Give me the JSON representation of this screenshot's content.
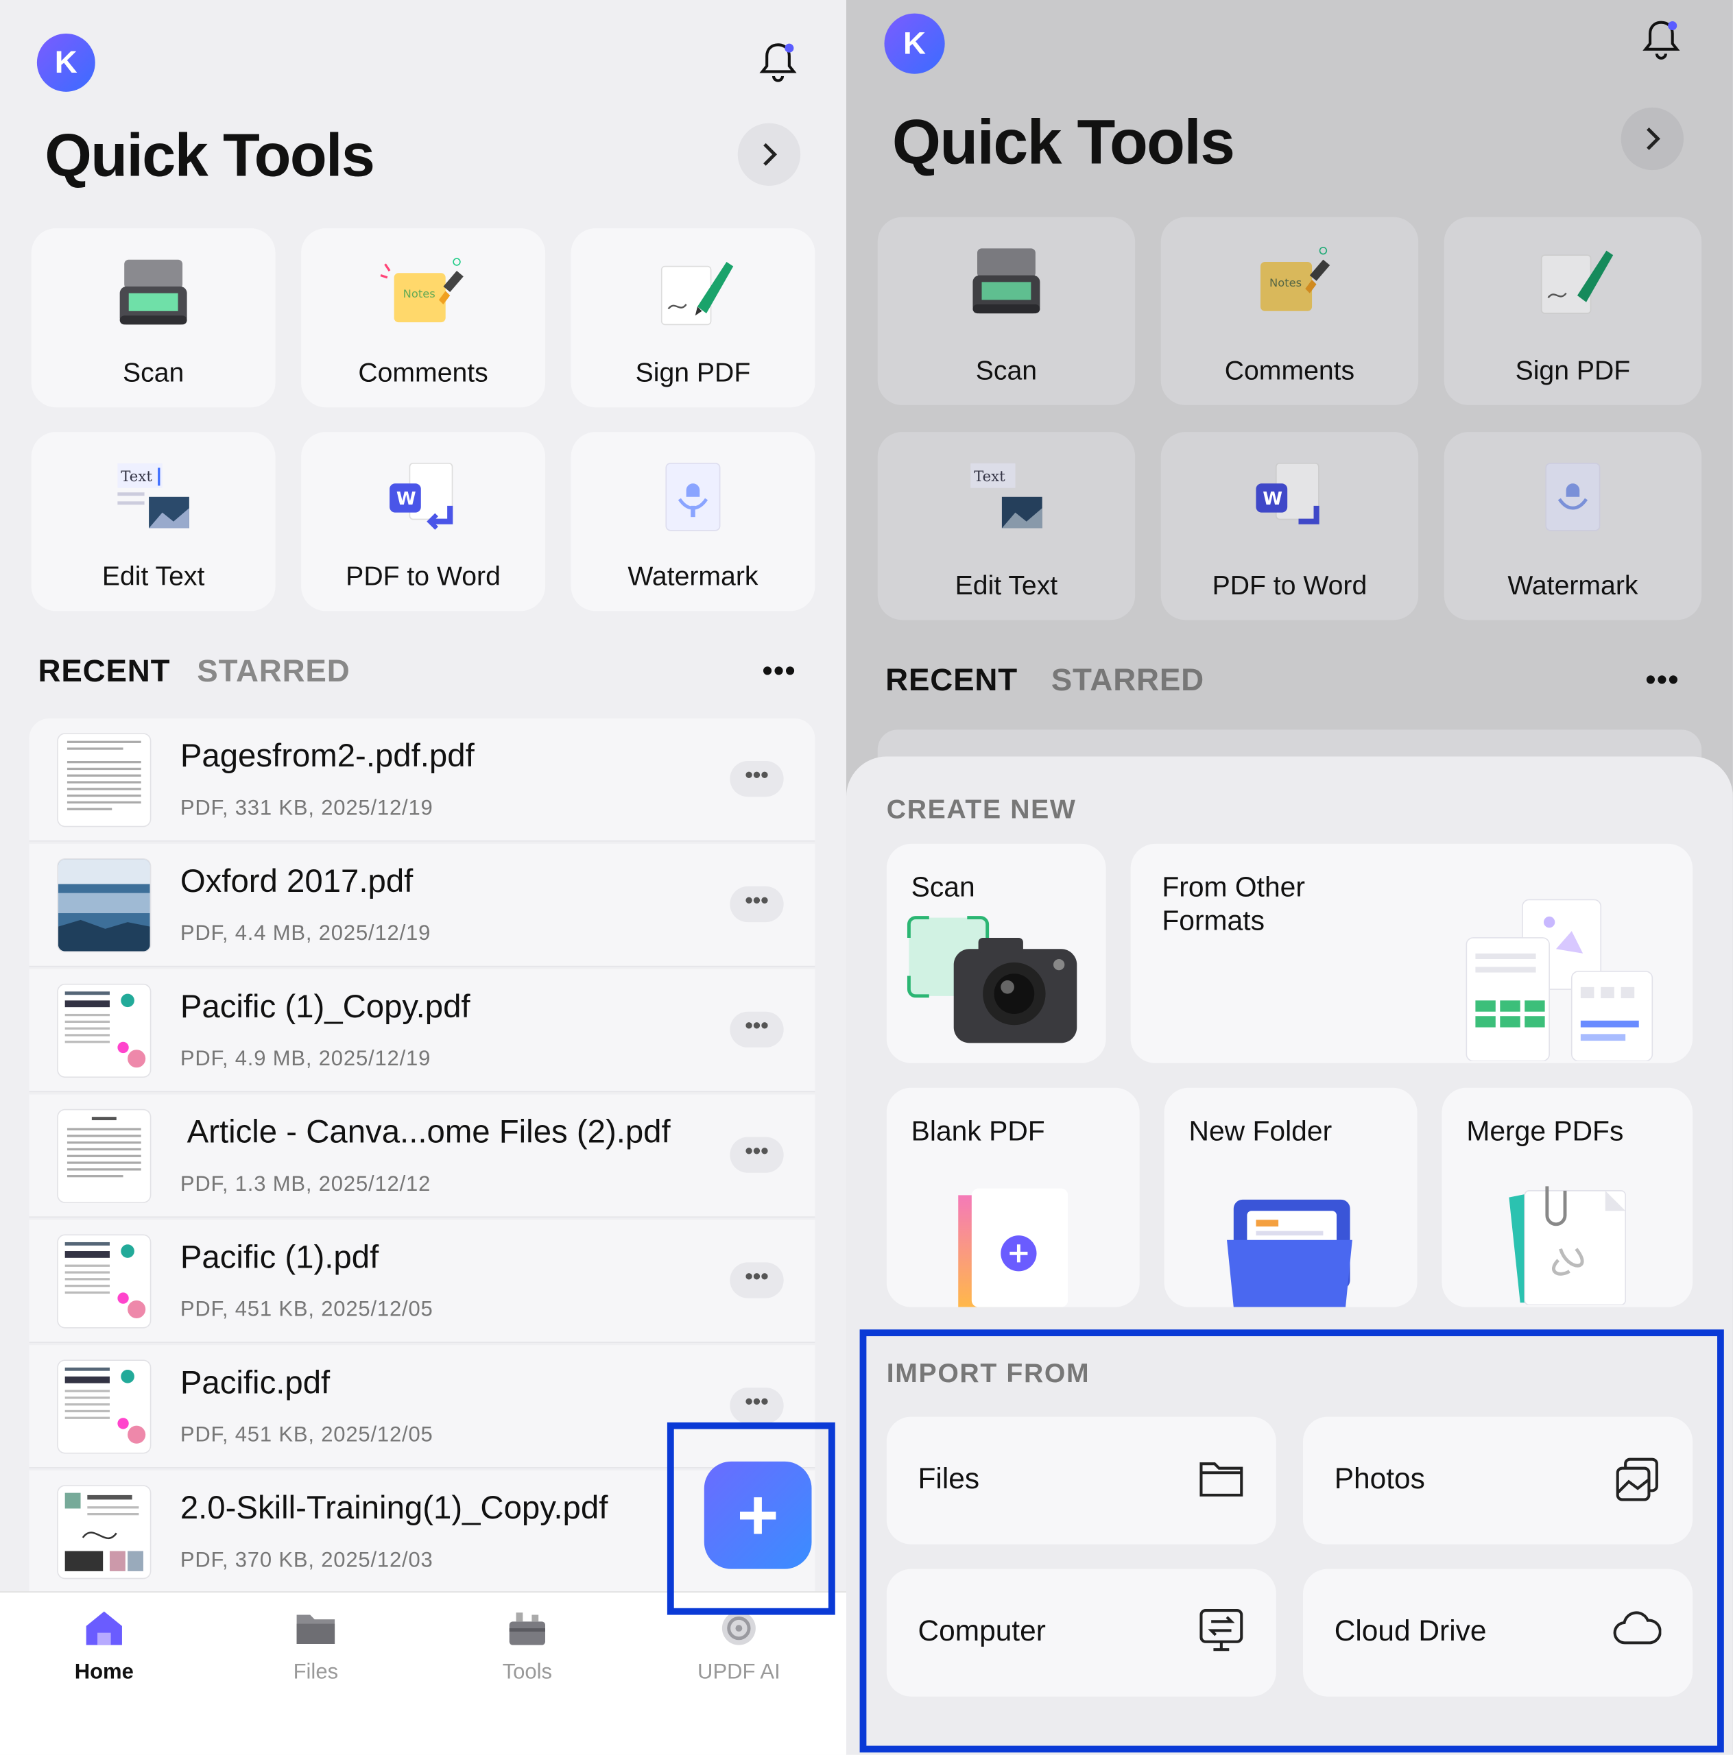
{
  "avatar_initial": "K",
  "header": {
    "title": "Quick Tools"
  },
  "quick_tools": [
    {
      "label": "Scan",
      "icon": "scanner-icon"
    },
    {
      "label": "Comments",
      "icon": "notes-icon"
    },
    {
      "label": "Sign PDF",
      "icon": "sign-pen-icon"
    },
    {
      "label": "Edit Text",
      "icon": "edit-text-icon"
    },
    {
      "label": "PDF to Word",
      "icon": "word-convert-icon"
    },
    {
      "label": "Watermark",
      "icon": "watermark-icon"
    }
  ],
  "tabs": {
    "recent": "RECENT",
    "starred": "STARRED"
  },
  "more_label": "•••",
  "files": [
    {
      "name": "Pagesfrom2-.pdf.pdf",
      "meta": "PDF, 331 KB, 2025/12/19"
    },
    {
      "name": "Oxford 2017.pdf",
      "meta": "PDF, 4.4 MB, 2025/12/19"
    },
    {
      "name": "Pacific (1)_Copy.pdf",
      "meta": "PDF, 4.9 MB, 2025/12/19"
    },
    {
      "name": "Article - Canva...ome Files (2).pdf",
      "meta": "PDF, 1.3 MB, 2025/12/12"
    },
    {
      "name": "Pacific (1).pdf",
      "meta": "PDF, 451 KB, 2025/12/05"
    },
    {
      "name": "Pacific.pdf",
      "meta": "PDF, 451 KB, 2025/12/05"
    },
    {
      "name": "2.0-Skill-Training(1)_Copy.pdf",
      "meta": "PDF, 370 KB, 2025/12/03"
    }
  ],
  "fab_label": "+",
  "bottom_nav": [
    {
      "label": "Home",
      "icon": "home-icon",
      "active": true
    },
    {
      "label": "Files",
      "icon": "folder-icon"
    },
    {
      "label": "Tools",
      "icon": "toolbox-icon"
    },
    {
      "label": "UPDF AI",
      "icon": "ai-icon"
    }
  ],
  "sheet": {
    "create_new_title": "CREATE NEW",
    "create_new": [
      {
        "label": "Scan",
        "icon": "camera-icon"
      },
      {
        "label": "From Other Formats",
        "icon": "formats-icon"
      },
      {
        "label": "Blank PDF",
        "icon": "blank-pdf-icon"
      },
      {
        "label": "New Folder",
        "icon": "new-folder-icon"
      },
      {
        "label": "Merge PDFs",
        "icon": "merge-icon"
      }
    ],
    "import_from_title": "IMPORT FROM",
    "import_from": [
      {
        "label": "Files",
        "icon": "folder-outline-icon"
      },
      {
        "label": "Photos",
        "icon": "photos-icon"
      },
      {
        "label": "Computer",
        "icon": "computer-transfer-icon"
      },
      {
        "label": "Cloud Drive",
        "icon": "cloud-icon"
      }
    ]
  },
  "colors": {
    "accent": "#3b6cff",
    "highlight": "#0a3ad6",
    "avatar": "#5a5cff"
  }
}
